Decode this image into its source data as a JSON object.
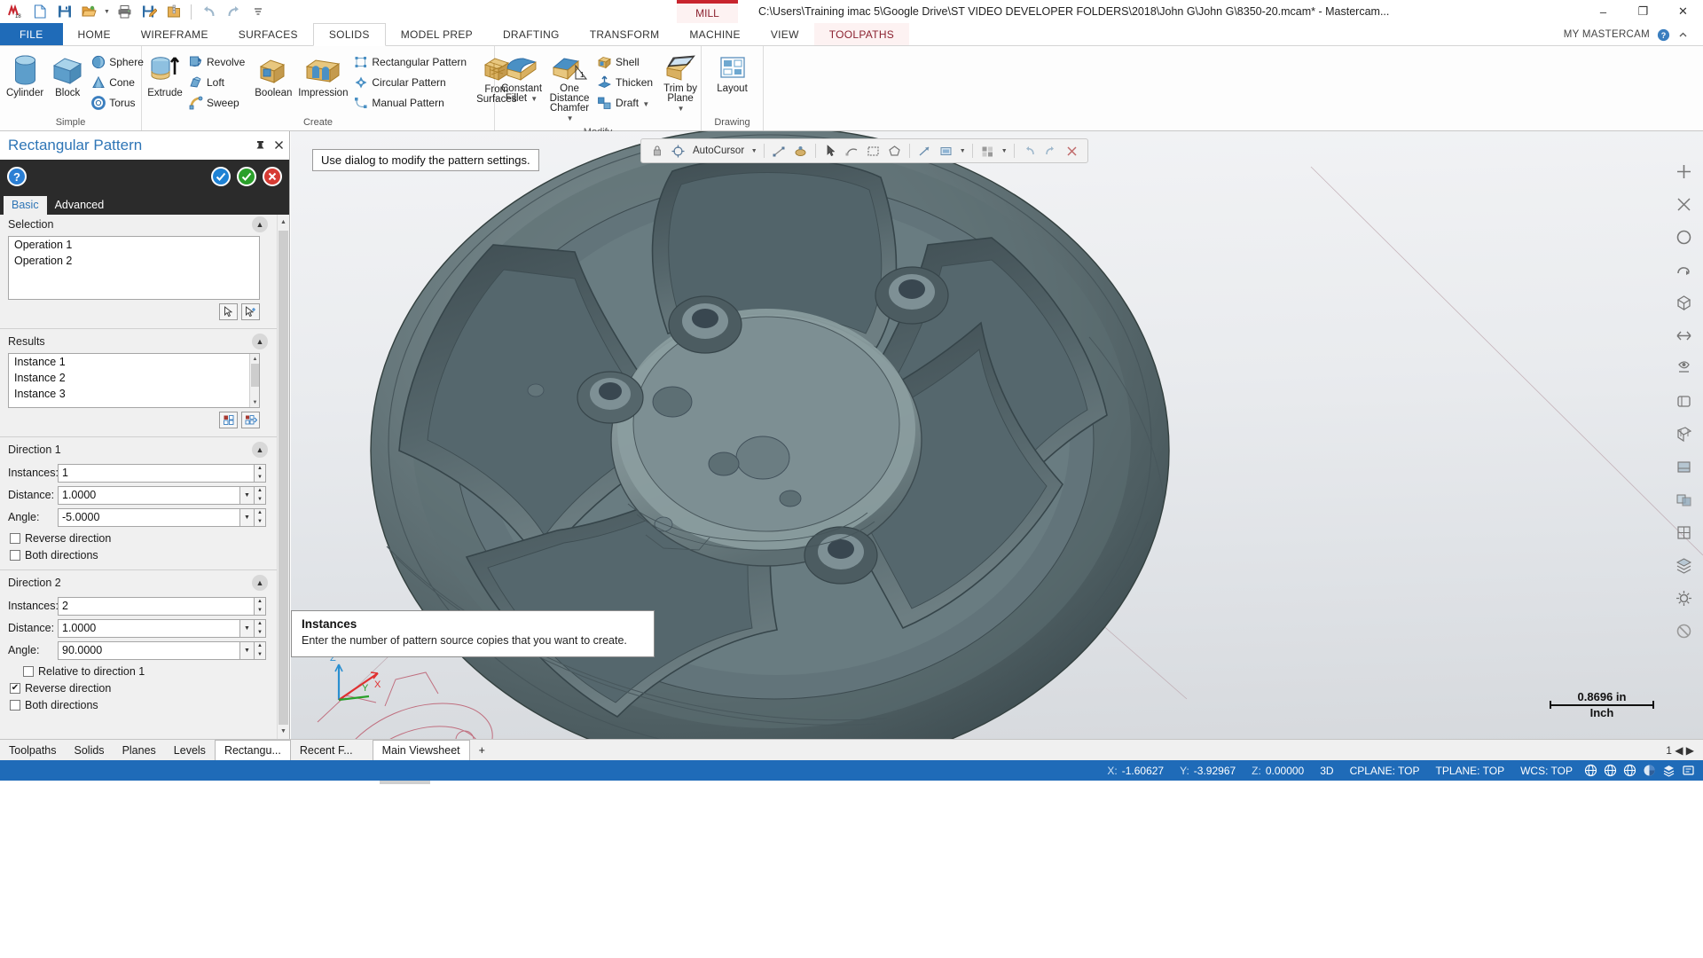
{
  "titlebar": {
    "context_tab": "MILL",
    "document_path": "C:\\Users\\Training imac 5\\Google Drive\\ST VIDEO DEVELOPER FOLDERS\\2018\\John G\\John G\\8350-20.mcam* - Mastercam...",
    "minimize": "–",
    "restore": "❐",
    "close": "✕",
    "quick_access": [
      {
        "name": "mastercam-logo-icon",
        "label": "Mastercam"
      },
      {
        "name": "new-file-icon",
        "label": "New"
      },
      {
        "name": "save-icon",
        "label": "Save"
      },
      {
        "name": "open-file-icon",
        "label": "Open"
      },
      {
        "name": "print-icon",
        "label": "Print"
      },
      {
        "name": "save-as-icon",
        "label": "Save As"
      },
      {
        "name": "zip2go-icon",
        "label": "Zip2Go"
      },
      {
        "name": "undo-icon",
        "label": "Undo"
      },
      {
        "name": "redo-icon",
        "label": "Redo"
      },
      {
        "name": "customize-qat-icon",
        "label": "Customize Quick Access Toolbar"
      }
    ]
  },
  "ribbon": {
    "tabs": [
      {
        "label": "FILE",
        "state": "file"
      },
      {
        "label": "HOME",
        "state": "normal"
      },
      {
        "label": "WIREFRAME",
        "state": "normal"
      },
      {
        "label": "SURFACES",
        "state": "normal"
      },
      {
        "label": "SOLIDS",
        "state": "active"
      },
      {
        "label": "MODEL PREP",
        "state": "normal"
      },
      {
        "label": "DRAFTING",
        "state": "normal"
      },
      {
        "label": "TRANSFORM",
        "state": "normal"
      },
      {
        "label": "MACHINE",
        "state": "normal"
      },
      {
        "label": "VIEW",
        "state": "normal"
      },
      {
        "label": "TOOLPATHS",
        "state": "context"
      }
    ],
    "my_mastercam": "MY MASTERCAM",
    "groups": [
      {
        "title": "Simple",
        "big": [
          {
            "label": "Cylinder",
            "icon": "cylinder-icon"
          },
          {
            "label": "Block",
            "icon": "block-icon"
          }
        ],
        "small": [
          {
            "label": "Sphere",
            "icon": "sphere-icon",
            "caret": false
          },
          {
            "label": "Cone",
            "icon": "cone-icon",
            "caret": false
          },
          {
            "label": "Torus",
            "icon": "torus-icon",
            "caret": false
          }
        ]
      },
      {
        "title": "Create",
        "big": [
          {
            "label": "Extrude",
            "icon": "extrude-icon"
          },
          {
            "label": "Boolean",
            "icon": "boolean-icon"
          },
          {
            "label": "Impression",
            "icon": "impression-icon"
          },
          {
            "label": "From Surfaces",
            "icon": "from-surfaces-icon"
          }
        ],
        "small": [
          {
            "label": "Revolve",
            "icon": "revolve-icon",
            "caret": false
          },
          {
            "label": "Loft",
            "icon": "loft-icon",
            "caret": false
          },
          {
            "label": "Sweep",
            "icon": "sweep-icon",
            "caret": false
          },
          {
            "label": "Rectangular Pattern",
            "icon": "rectangular-pattern-icon",
            "caret": false
          },
          {
            "label": "Circular Pattern",
            "icon": "circular-pattern-icon",
            "caret": false
          },
          {
            "label": "Manual Pattern",
            "icon": "manual-pattern-icon",
            "caret": false
          }
        ]
      },
      {
        "title": "Modify",
        "big": [
          {
            "label": "Constant Fillet",
            "icon": "constant-fillet-icon",
            "caret": true
          },
          {
            "label": "One Distance Chamfer",
            "icon": "one-distance-chamfer-icon",
            "caret": true
          },
          {
            "label": "Trim by Plane",
            "icon": "trim-by-plane-icon",
            "caret": true
          }
        ],
        "small": [
          {
            "label": "Shell",
            "icon": "shell-icon",
            "caret": false
          },
          {
            "label": "Thicken",
            "icon": "thicken-icon",
            "caret": false
          },
          {
            "label": "Draft",
            "icon": "draft-icon",
            "caret": true
          }
        ]
      },
      {
        "title": "Drawing",
        "big": [
          {
            "label": "Layout",
            "icon": "layout-icon"
          }
        ],
        "small": []
      }
    ]
  },
  "panel": {
    "title": "Rectangular Pattern",
    "pin_icon": "pin-icon",
    "close_icon": "close-icon",
    "help_icon": "help-icon",
    "apply_icon": "apply-and-create-new-icon",
    "ok_icon": "ok-icon",
    "cancel_icon": "cancel-icon",
    "tabs": [
      {
        "label": "Basic",
        "active": true
      },
      {
        "label": "Advanced",
        "active": false
      }
    ],
    "selection": {
      "header": "Selection",
      "items": [
        "Operation 1",
        "Operation 2"
      ],
      "buttons": [
        {
          "name": "reselect-button",
          "icon": "cursor-arrow-icon"
        },
        {
          "name": "select-all-button",
          "icon": "cursor-arrow-plus-icon"
        }
      ]
    },
    "results": {
      "header": "Results",
      "items": [
        "Instance 1",
        "Instance 2",
        "Instance 3"
      ],
      "buttons": [
        {
          "name": "toggle-instance-button",
          "icon": "grid-toggle-icon"
        },
        {
          "name": "toggle-all-instances-button",
          "icon": "grid-toggle-all-icon"
        }
      ]
    },
    "direction1": {
      "header": "Direction 1",
      "instances_label": "Instances:",
      "instances_value": "1",
      "distance_label": "Distance:",
      "distance_value": "1.0000",
      "angle_label": "Angle:",
      "angle_value": "-5.0000",
      "reverse_label": "Reverse direction",
      "reverse_checked": false,
      "both_label": "Both directions",
      "both_checked": false
    },
    "direction2": {
      "header": "Direction 2",
      "instances_label": "Instances:",
      "instances_value": "2",
      "distance_label": "Distance:",
      "distance_value": "1.0000",
      "angle_label": "Angle:",
      "angle_value": "90.0000",
      "relative_label": "Relative to direction 1",
      "relative_checked": false,
      "reverse_label": "Reverse direction",
      "reverse_checked": true,
      "both_label": "Both directions",
      "both_checked": false
    }
  },
  "viewport": {
    "message": "Use dialog to modify the pattern settings.",
    "autocursor_label": "AutoCursor",
    "scale_value": "0.8696 in",
    "scale_unit": "Inch",
    "gnomon": {
      "x": "X",
      "y": "Y",
      "z": "Z"
    },
    "tooltip": {
      "title": "Instances",
      "body": "Enter the number of pattern source copies that you want to create."
    },
    "right_tools": [
      {
        "name": "fit-icon"
      },
      {
        "name": "unzoom-icon"
      },
      {
        "name": "zoom-window-icon"
      },
      {
        "name": "dynamic-rotate-icon"
      },
      {
        "name": "isometric-view-icon"
      },
      {
        "name": "top-view-icon"
      },
      {
        "name": "front-view-icon"
      },
      {
        "name": "right-view-icon"
      },
      {
        "name": "wireframe-shading-icon"
      },
      {
        "name": "shaded-icon"
      },
      {
        "name": "translucency-icon"
      },
      {
        "name": "wireframe-icon"
      },
      {
        "name": "levels-icon"
      },
      {
        "name": "settings-icon"
      },
      {
        "name": "blank-icon"
      }
    ],
    "toolbar_icons": [
      {
        "name": "autocursor-target-icon"
      },
      {
        "name": "autocursor-dropdown-icon"
      },
      {
        "name": "endpoint-snap-icon"
      },
      {
        "name": "midpoint-snap-icon"
      },
      {
        "name": "select-arrow-icon"
      },
      {
        "name": "chain-select-icon"
      },
      {
        "name": "window-select-icon"
      },
      {
        "name": "polygon-select-icon"
      },
      {
        "name": "vector-select-icon"
      },
      {
        "name": "single-select-icon"
      },
      {
        "name": "select-mode-icon"
      },
      {
        "name": "select-filter-icon"
      },
      {
        "name": "analyze-icon"
      },
      {
        "name": "undo-select-icon"
      },
      {
        "name": "redo-select-icon"
      },
      {
        "name": "clear-select-icon"
      }
    ]
  },
  "bottom_tabs": {
    "left": [
      {
        "label": "Toolpaths",
        "selected": false
      },
      {
        "label": "Solids",
        "selected": false
      },
      {
        "label": "Planes",
        "selected": false
      },
      {
        "label": "Levels",
        "selected": false
      },
      {
        "label": "Rectangu...",
        "selected": true
      },
      {
        "label": "Recent F...",
        "selected": false
      }
    ],
    "viewsheets": [
      {
        "label": "Main Viewsheet",
        "selected": true
      },
      {
        "label": "+",
        "selected": false
      }
    ],
    "scroll_indicator": "1  ◀  ▶"
  },
  "statusbar": {
    "coords": [
      {
        "label": "X:",
        "value": "-1.60627"
      },
      {
        "label": "Y:",
        "value": "-3.92967"
      },
      {
        "label": "Z:",
        "value": "0.00000"
      }
    ],
    "mode": "3D",
    "planes": [
      {
        "label": "CPLANE: TOP"
      },
      {
        "label": "TPLANE: TOP"
      },
      {
        "label": "WCS: TOP"
      }
    ],
    "icons": [
      {
        "name": "globe-cplane-icon"
      },
      {
        "name": "globe-tplane-icon"
      },
      {
        "name": "globe-wcs-icon"
      },
      {
        "name": "color-swatch-icon"
      },
      {
        "name": "level-icon"
      },
      {
        "name": "attributes-icon"
      }
    ]
  }
}
